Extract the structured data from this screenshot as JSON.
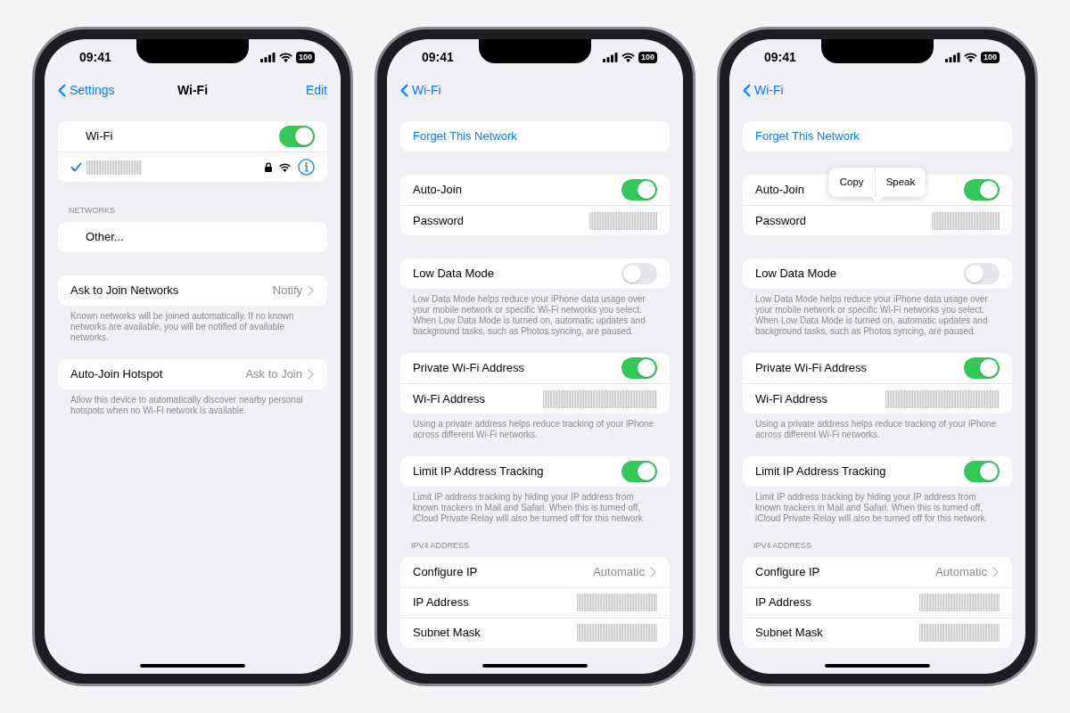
{
  "phones": [
    {
      "status": {
        "time": "09:41",
        "battery": "100"
      },
      "nav": {
        "back": "Settings",
        "title": "Wi-Fi",
        "action": "Edit"
      },
      "sections": [
        {
          "kind": "networks",
          "rows": [
            {
              "kind": "toggle",
              "label": "Wi-Fi",
              "on": true
            },
            {
              "kind": "network",
              "checked": true
            }
          ]
        },
        {
          "kind": "networks",
          "header": "NETWORKS",
          "rows": [
            {
              "kind": "plain",
              "label": "Other..."
            }
          ]
        },
        {
          "kind": "settings",
          "rows": [
            {
              "kind": "value",
              "label": "Ask to Join Networks",
              "value": "Notify"
            }
          ],
          "footer": "Known networks will be joined automatically. If no known networks are available, you will be notified of available networks."
        },
        {
          "kind": "settings",
          "rows": [
            {
              "kind": "value",
              "label": "Auto-Join Hotspot",
              "value": "Ask to Join"
            }
          ],
          "footer": "Allow this device to automatically discover nearby personal hotspots when no Wi-Fi network is available."
        }
      ]
    },
    {
      "status": {
        "time": "09:41",
        "battery": "100"
      },
      "nav": {
        "back": "Wi-Fi"
      },
      "sections": [
        {
          "kind": "settings",
          "rows": [
            {
              "kind": "link",
              "label": "Forget This Network"
            }
          ]
        },
        {
          "kind": "settings",
          "rows": [
            {
              "kind": "toggle",
              "label": "Auto-Join",
              "on": true
            },
            {
              "kind": "redacted",
              "label": "Password"
            }
          ]
        },
        {
          "kind": "settings",
          "rows": [
            {
              "kind": "toggle",
              "label": "Low Data Mode",
              "on": false
            }
          ],
          "footer": "Low Data Mode helps reduce your iPhone data usage over your mobile network or specific Wi-Fi networks you select. When Low Data Mode is turned on, automatic updates and background tasks, such as Photos syncing, are paused."
        },
        {
          "kind": "settings",
          "rows": [
            {
              "kind": "toggle",
              "label": "Private Wi-Fi Address",
              "on": true
            },
            {
              "kind": "redacted",
              "label": "Wi-Fi Address"
            }
          ],
          "footer": "Using a private address helps reduce tracking of your iPhone across different Wi-Fi networks."
        },
        {
          "kind": "settings",
          "rows": [
            {
              "kind": "toggle",
              "label": "Limit IP Address Tracking",
              "on": true
            }
          ],
          "footer": "Limit IP address tracking by hiding your IP address from known trackers in Mail and Safari. When this is turned off, iCloud Private Relay will also be turned off for this network."
        },
        {
          "kind": "settings",
          "header": "IPV4 ADDRESS",
          "rows": [
            {
              "kind": "value",
              "label": "Configure IP",
              "value": "Automatic"
            },
            {
              "kind": "redacted",
              "label": "IP Address"
            },
            {
              "kind": "redacted",
              "label": "Subnet Mask"
            }
          ]
        }
      ]
    },
    {
      "status": {
        "time": "09:41",
        "battery": "100"
      },
      "nav": {
        "back": "Wi-Fi"
      },
      "sections": [
        {
          "kind": "settings",
          "rows": [
            {
              "kind": "link",
              "label": "Forget This Network"
            }
          ]
        },
        {
          "kind": "settings",
          "rows": [
            {
              "kind": "toggle",
              "label": "Auto-Join",
              "on": true
            },
            {
              "kind": "redacted",
              "label": "Password",
              "menu": [
                "Copy",
                "Speak"
              ]
            }
          ]
        },
        {
          "kind": "settings",
          "rows": [
            {
              "kind": "toggle",
              "label": "Low Data Mode",
              "on": false
            }
          ],
          "footer": "Low Data Mode helps reduce your iPhone data usage over your mobile network or specific Wi-Fi networks you select. When Low Data Mode is turned on, automatic updates and background tasks, such as Photos syncing, are paused."
        },
        {
          "kind": "settings",
          "rows": [
            {
              "kind": "toggle",
              "label": "Private Wi-Fi Address",
              "on": true
            },
            {
              "kind": "redacted",
              "label": "Wi-Fi Address"
            }
          ],
          "footer": "Using a private address helps reduce tracking of your iPhone across different Wi-Fi networks."
        },
        {
          "kind": "settings",
          "rows": [
            {
              "kind": "toggle",
              "label": "Limit IP Address Tracking",
              "on": true
            }
          ],
          "footer": "Limit IP address tracking by hiding your IP address from known trackers in Mail and Safari. When this is turned off, iCloud Private Relay will also be turned off for this network."
        },
        {
          "kind": "settings",
          "header": "IPV4 ADDRESS",
          "rows": [
            {
              "kind": "value",
              "label": "Configure IP",
              "value": "Automatic"
            },
            {
              "kind": "redacted",
              "label": "IP Address"
            },
            {
              "kind": "redacted",
              "label": "Subnet Mask"
            }
          ]
        }
      ]
    }
  ]
}
